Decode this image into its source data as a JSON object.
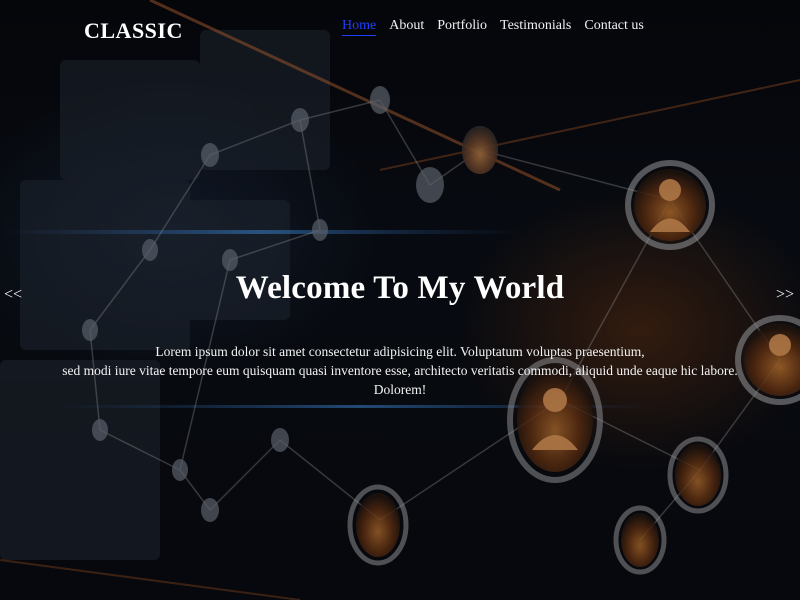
{
  "brand": {
    "name": "CLASSIC"
  },
  "nav": {
    "items": [
      {
        "label": "Home",
        "active": true
      },
      {
        "label": "About",
        "active": false
      },
      {
        "label": "Portfolio",
        "active": false
      },
      {
        "label": "Testimonials",
        "active": false
      },
      {
        "label": "Contact us",
        "active": false
      }
    ]
  },
  "hero": {
    "title": "Welcome To My World",
    "text_line1": "Lorem ipsum dolor sit amet consectetur adipisicing elit. Voluptatum voluptas praesentium,",
    "text_line2": "sed modi iure vitae tempore eum quisquam quasi inventore esse, architecto veritatis commodi, aliquid unde eaque hic labore. Dolorem!"
  },
  "carousel": {
    "prev_label": "<<",
    "next_label": ">>"
  },
  "colors": {
    "active_link": "#1f3fff",
    "text": "#ffffff",
    "background": "#05070c"
  }
}
